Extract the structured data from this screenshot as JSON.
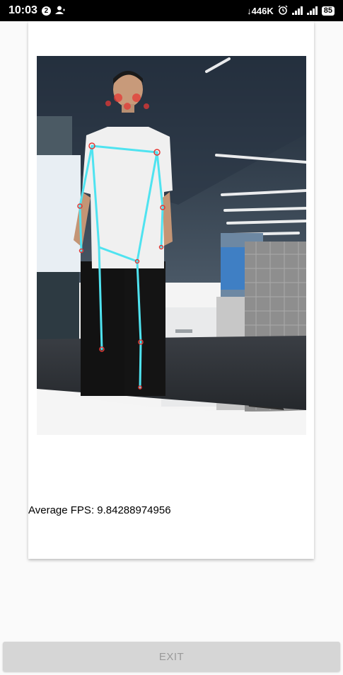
{
  "status_bar": {
    "time": "10:03",
    "notification_count": "2",
    "net_speed": "↓446K",
    "battery_level": "85"
  },
  "camera_view": {
    "pose_overlay_color": "#4fe3f0",
    "keypoint_color": "#e53935"
  },
  "stats": {
    "fps_label": "Average FPS: 9.84288974956"
  },
  "controls": {
    "exit_label": "EXIT"
  }
}
